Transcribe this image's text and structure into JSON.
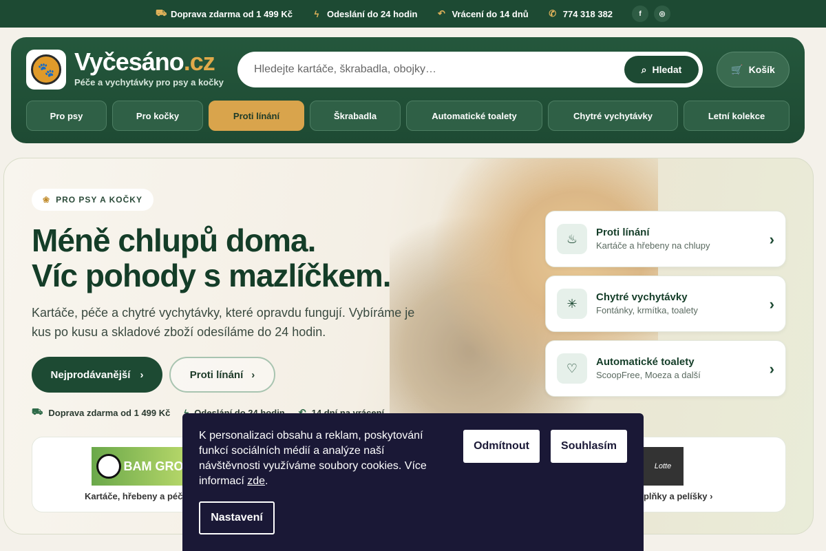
{
  "topbar": {
    "shipping": "Doprava zdarma od 1 499 Kč",
    "dispatch": "Odeslání do 24 hodin",
    "returns": "Vrácení do 14 dnů",
    "phone": "774 318 382",
    "facebook": "f",
    "instagram": "◎"
  },
  "header": {
    "brand_name": "Vyčesáno",
    "brand_tld": ".cz",
    "tagline": "Péče a vychytávky pro psy a kočky",
    "search_placeholder": "Hledejte kartáče, škrabadla, obojky…",
    "search_button": "Hledat",
    "cart_label": "Košík"
  },
  "nav": [
    {
      "label": "Pro psy",
      "width": 117,
      "active": false
    },
    {
      "label": "Pro kočky",
      "width": 132,
      "active": false
    },
    {
      "label": "Proti línání",
      "width": 139,
      "active": true
    },
    {
      "label": "Škrabadla",
      "width": 132,
      "active": false
    },
    {
      "label": "Automatické toalety",
      "width": 198,
      "active": false
    },
    {
      "label": "Chytré vychytávky",
      "width": 189,
      "active": false
    },
    {
      "label": "Letní kolekce",
      "width": 154,
      "active": false
    }
  ],
  "hero": {
    "pill": "PRO PSY A KOČKY",
    "headline_1": "Méně chlupů doma.",
    "headline_2": "Víc pohody s mazlíčkem.",
    "subtitle": "Kartáče, péče a chytré vychytávky, které opravdu fungují. Vybíráme je kus po kusu a skladové zboží odesíláme do 24 hodin.",
    "cta_primary": "Nejprodávanější",
    "cta_secondary": "Proti línání",
    "perk_shipping": "Doprava zdarma od 1 499 Kč",
    "perk_dispatch": "Odeslání do 24 hodin",
    "perk_returns": "14 dní na vrácení"
  },
  "cards": [
    {
      "title": "Proti línání",
      "subtitle": "Kartáče a hřebeny na chlupy",
      "icon": "brush-icon"
    },
    {
      "title": "Chytré vychytávky",
      "subtitle": "Fontánky, krmítka, toalety",
      "icon": "sparkle-icon"
    },
    {
      "title": "Automatické toalety",
      "subtitle": "ScoopFree, Moeza a další",
      "icon": "heart-plus-icon"
    }
  ],
  "brands": {
    "bamboo_label": "Kartáče, hřebeny a péče",
    "bamboo_text": "BAM GRO",
    "lotte_text": "Lotte",
    "lotte_label": "oplňky a pelíšky"
  },
  "cookie": {
    "text_1": "K personalizaci obsahu a reklam, poskytování funkcí sociálních médií a analýze naší návštěvnosti využíváme soubory cookies. Více informací ",
    "link": "zde",
    "text_2": ".",
    "deny": "Odmítnout",
    "accept": "Souhlasím",
    "settings": "Nastavení"
  }
}
